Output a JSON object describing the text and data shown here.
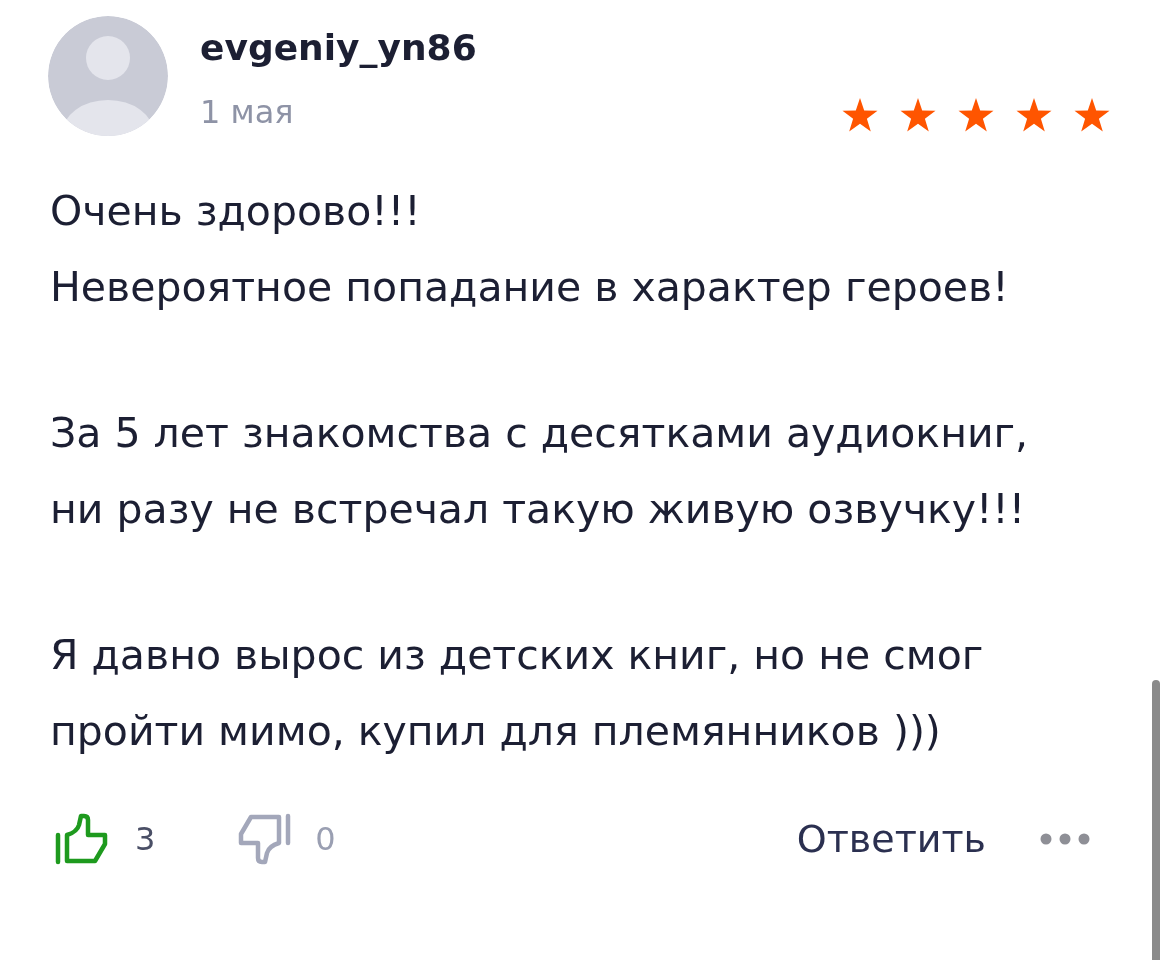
{
  "review": {
    "author": "evgeniy_yn86",
    "date": "1 мая",
    "stars": 5,
    "paragraphs": [
      "Очень здорово!!!\nНевероятное попадание в характер героев!",
      "За 5 лет знакомства с десятками аудиокниг,\nни разу не встречал такую живую озвучку!!!",
      "Я давно вырос из детских книг, но не смог\nпройти мимо, купил для племянников )))"
    ],
    "likes": "3",
    "dislikes": "0",
    "reply_label": "Ответить"
  }
}
